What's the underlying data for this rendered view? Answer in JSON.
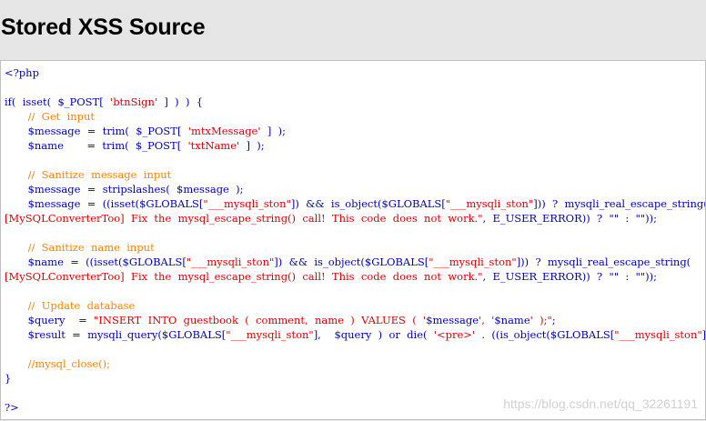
{
  "header": {
    "title": "Stored XSS Source"
  },
  "code_lines": [
    [
      {
        "t": "php",
        "v": "<?php"
      }
    ],
    [
      {
        "t": "kw",
        "v": ""
      }
    ],
    [
      {
        "t": "kw",
        "v": "if(  isset(  $_POST[  "
      },
      {
        "t": "str",
        "v": "'btnSign'"
      },
      {
        "t": "kw",
        "v": "  ]  )  )  {"
      }
    ],
    [
      {
        "t": "cmt",
        "v": "       //  Get  input"
      }
    ],
    [
      {
        "t": "kw",
        "v": "       $message  =  trim(  $_POST[  "
      },
      {
        "t": "str",
        "v": "'mtxMessage'"
      },
      {
        "t": "kw",
        "v": "  ]  );"
      }
    ],
    [
      {
        "t": "kw",
        "v": "       $name       =  trim(  $_POST[  "
      },
      {
        "t": "str",
        "v": "'txtName'"
      },
      {
        "t": "kw",
        "v": "  ]  );"
      }
    ],
    [
      {
        "t": "kw",
        "v": ""
      }
    ],
    [
      {
        "t": "cmt",
        "v": "       //  Sanitize  message  input"
      }
    ],
    [
      {
        "t": "kw",
        "v": "       $message  =  stripslashes(  $message  );"
      }
    ],
    [
      {
        "t": "kw",
        "v": "       $message  =  ((isset($GLOBALS["
      },
      {
        "t": "str",
        "v": "\"___mysqli_ston\""
      },
      {
        "t": "kw",
        "v": "])  &&  is_object($GLOBALS["
      },
      {
        "t": "str",
        "v": "\"___mysqli_ston\""
      },
      {
        "t": "kw",
        "v": "]))  ?  mysqli_real_escape_string("
      }
    ],
    [
      {
        "t": "str",
        "v": "[MySQLConverterToo]  Fix  the  mysql_escape_string()  call!  This  code  does  not  work.\""
      },
      {
        "t": "kw",
        "v": ",  E_USER_ERROR))  ?  \"\"  :  \"\"));"
      }
    ],
    [
      {
        "t": "kw",
        "v": ""
      }
    ],
    [
      {
        "t": "cmt",
        "v": "       //  Sanitize  name  input"
      }
    ],
    [
      {
        "t": "kw",
        "v": "       $name  =  ((isset($GLOBALS["
      },
      {
        "t": "str",
        "v": "\"___mysqli_ston\""
      },
      {
        "t": "kw",
        "v": "])  &&  is_object($GLOBALS["
      },
      {
        "t": "str",
        "v": "\"___mysqli_ston\""
      },
      {
        "t": "kw",
        "v": "]))  ?  mysqli_real_escape_string("
      }
    ],
    [
      {
        "t": "str",
        "v": "[MySQLConverterToo]  Fix  the  mysql_escape_string()  call!  This  code  does  not  work.\""
      },
      {
        "t": "kw",
        "v": ",  E_USER_ERROR))  ?  \"\"  :  \"\"));"
      }
    ],
    [
      {
        "t": "kw",
        "v": ""
      }
    ],
    [
      {
        "t": "cmt",
        "v": "       //  Update  database"
      }
    ],
    [
      {
        "t": "kw",
        "v": "       $query    =  "
      },
      {
        "t": "str",
        "v": "\"INSERT  INTO  guestbook  (  comment,  name  )  VALUES  (  '"
      },
      {
        "t": "kw",
        "v": "$message"
      },
      {
        "t": "str",
        "v": "',  '"
      },
      {
        "t": "kw",
        "v": "$name"
      },
      {
        "t": "str",
        "v": "'  );\""
      },
      {
        "t": "kw",
        "v": ";"
      }
    ],
    [
      {
        "t": "kw",
        "v": "       $result  =  mysqli_query($GLOBALS["
      },
      {
        "t": "str",
        "v": "\"___mysqli_ston\""
      },
      {
        "t": "kw",
        "v": "],    $query  )  or  die(  "
      },
      {
        "t": "str",
        "v": "'<pre>'"
      },
      {
        "t": "kw",
        "v": "  .  ((is_object($GLOBALS["
      },
      {
        "t": "str",
        "v": "\"___mysqli_ston\""
      },
      {
        "t": "kw",
        "v": "]))  ?"
      }
    ],
    [
      {
        "t": "kw",
        "v": ""
      }
    ],
    [
      {
        "t": "cmt",
        "v": "       //mysql_close();"
      }
    ],
    [
      {
        "t": "kw",
        "v": "}"
      }
    ],
    [
      {
        "t": "kw",
        "v": ""
      }
    ],
    [
      {
        "t": "php",
        "v": "?>"
      }
    ]
  ],
  "watermark": "https://blog.csdn.net/qq_32261191",
  "colors": {
    "keyword": "#0000bb",
    "string": "#dd0000",
    "comment": "#ff8000",
    "header_bg": "#e6e6e6"
  }
}
